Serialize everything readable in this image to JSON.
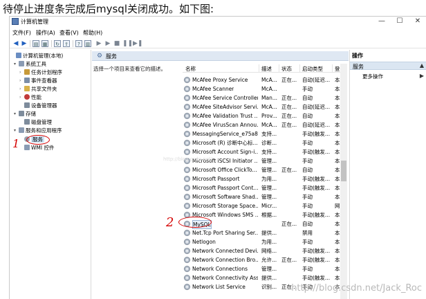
{
  "caption": "待停止进度条完成后mysql关闭成功。如下图:",
  "window": {
    "title": "计算机管理",
    "minimize": "—",
    "maximize": "☐",
    "close": "✕"
  },
  "menu": [
    "文件(F)",
    "操作(A)",
    "查看(V)",
    "帮助(H)"
  ],
  "tree": [
    {
      "label": "计算机管理(本地)",
      "arrow": "",
      "icon_color": "#6a8dc2"
    },
    {
      "label": "系统工具",
      "arrow": "▾",
      "icon_color": "#8a9bb3"
    },
    {
      "label": "任务计划程序",
      "arrow": "›",
      "icon_color": "#c79a3a"
    },
    {
      "label": "事件查看器",
      "arrow": "›",
      "icon_color": "#7b8ea8"
    },
    {
      "label": "共享文件夹",
      "arrow": "›",
      "icon_color": "#d8b24a"
    },
    {
      "label": "性能",
      "arrow": "›",
      "icon_color": "#c23b3b"
    },
    {
      "label": "设备管理器",
      "arrow": "",
      "icon_color": "#7e8c9c"
    },
    {
      "label": "存储",
      "arrow": "▾",
      "icon_color": "#7e8c9c"
    },
    {
      "label": "磁盘管理",
      "arrow": "",
      "icon_color": "#7e8c9c"
    },
    {
      "label": "服务和应用程序",
      "arrow": "▾",
      "icon_color": "#8a9bb3"
    },
    {
      "label": "服务",
      "arrow": "",
      "icon_color": "#98a3b0"
    },
    {
      "label": "WMI 控件",
      "arrow": "",
      "icon_color": "#8a9bb3"
    }
  ],
  "center": {
    "title": "服务",
    "description": "选择一个项目来查看它的描述。",
    "columns": [
      "名称",
      "描述",
      "状态",
      "启动类型",
      "登"
    ]
  },
  "services": [
    {
      "name": "McAfee Proxy Service",
      "desc": "McA...",
      "status": "正在...",
      "startup": "自动(延迟...",
      "logon": "本"
    },
    {
      "name": "McAfee Scanner",
      "desc": "McA...",
      "status": "",
      "startup": "手动",
      "logon": "本"
    },
    {
      "name": "McAfee Service Controller",
      "desc": "Man...",
      "status": "正在...",
      "startup": "自动",
      "logon": "本"
    },
    {
      "name": "McAfee SiteAdvisor Servi...",
      "desc": "McA...",
      "status": "正在...",
      "startup": "自动(延迟...",
      "logon": "本"
    },
    {
      "name": "McAfee Validation Trust ...",
      "desc": "Prov...",
      "status": "正在...",
      "startup": "自动",
      "logon": "本"
    },
    {
      "name": "McAfee VirusScan Annou...",
      "desc": "McA...",
      "status": "正在...",
      "startup": "自动(延迟...",
      "logon": "本"
    },
    {
      "name": "MessagingService_e75a8...",
      "desc": "支持...",
      "status": "",
      "startup": "手动(触发...",
      "logon": "本"
    },
    {
      "name": "Microsoft (R) 诊断中心标...",
      "desc": "诊断...",
      "status": "",
      "startup": "手动",
      "logon": "本"
    },
    {
      "name": "Microsoft Account Sign-i...",
      "desc": "支持...",
      "status": "",
      "startup": "手动(触发...",
      "logon": "本"
    },
    {
      "name": "Microsoft iSCSI Initiator ...",
      "desc": "管理...",
      "status": "",
      "startup": "手动",
      "logon": "本"
    },
    {
      "name": "Microsoft Office ClickTo...",
      "desc": "管理...",
      "status": "正在...",
      "startup": "自动",
      "logon": "本"
    },
    {
      "name": "Microsoft Passport",
      "desc": "为用...",
      "status": "",
      "startup": "手动(触发...",
      "logon": "本"
    },
    {
      "name": "Microsoft Passport Cont...",
      "desc": "管理...",
      "status": "",
      "startup": "手动(触发...",
      "logon": "本"
    },
    {
      "name": "Microsoft Software Shad...",
      "desc": "管理...",
      "status": "",
      "startup": "手动",
      "logon": "本"
    },
    {
      "name": "Microsoft Storage Space...",
      "desc": "Micr...",
      "status": "",
      "startup": "手动",
      "logon": "网"
    },
    {
      "name": "Microsoft Windows SMS ...",
      "desc": "根据...",
      "status": "",
      "startup": "手动(触发...",
      "logon": "本"
    },
    {
      "name": "MySQL",
      "desc": "",
      "status": "正在...",
      "startup": "自动",
      "logon": "本"
    },
    {
      "name": "Net.Tcp Port Sharing Ser...",
      "desc": "提供...",
      "status": "",
      "startup": "禁用",
      "logon": "本"
    },
    {
      "name": "Netlogon",
      "desc": "为用...",
      "status": "",
      "startup": "手动",
      "logon": "本"
    },
    {
      "name": "Network Connected Devi...",
      "desc": "网络...",
      "status": "",
      "startup": "手动(触发...",
      "logon": "本"
    },
    {
      "name": "Network Connection Bro...",
      "desc": "允许...",
      "status": "正在...",
      "startup": "手动(触发...",
      "logon": "本"
    },
    {
      "name": "Network Connections",
      "desc": "管理...",
      "status": "",
      "startup": "手动",
      "logon": "本"
    },
    {
      "name": "Network Connectivity Ass...",
      "desc": "提供...",
      "status": "",
      "startup": "手动(触发...",
      "logon": "本"
    },
    {
      "name": "Network List Service",
      "desc": "识别...",
      "status": "正在...",
      "startup": "手动",
      "logon": "本"
    }
  ],
  "actions": {
    "header": "操作",
    "group": "服务",
    "group_caret": "▲",
    "more": "更多操作",
    "more_caret": "▶"
  },
  "annotations": {
    "one": "1",
    "two": "2"
  },
  "watermark": "http://blog.csdn.net/Jack_Roc",
  "watermark_faint": "http://blog.csdn.net/"
}
